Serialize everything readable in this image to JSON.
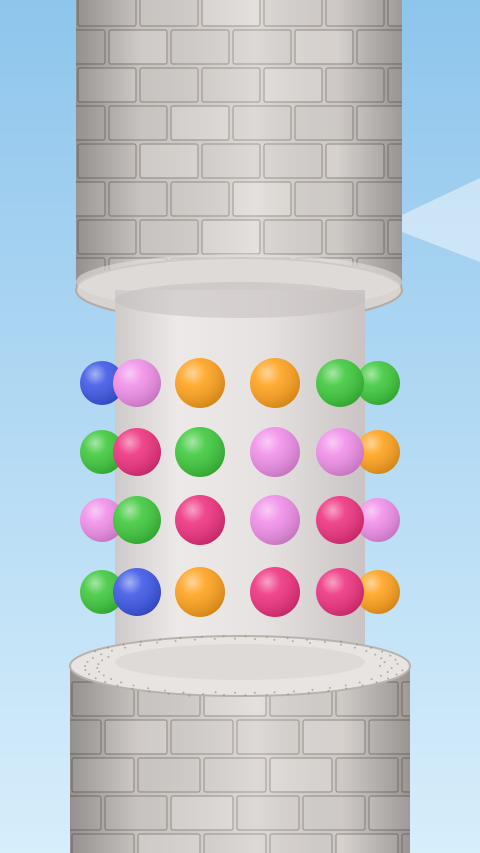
{
  "scene": {
    "title": "",
    "colors": {
      "sky_top": "#8ec5ec",
      "sky_bottom": "#d7eefb",
      "brick": "#d9d4d0",
      "brick_dark": "#a59d98",
      "mortar": "#8e8681",
      "core": "#e9e6e5",
      "core_shadow": "#c9c4c3"
    },
    "ball_colors": {
      "blue": "#3b55e6",
      "pink": "#f08de8",
      "orange": "#ffa11a",
      "green": "#3cc83a",
      "magenta": "#ee2f7d"
    },
    "balls": [
      {
        "row": 1,
        "col": 0,
        "color": "blue"
      },
      {
        "row": 1,
        "col": 1,
        "color": "pink"
      },
      {
        "row": 1,
        "col": 2,
        "color": "orange"
      },
      {
        "row": 1,
        "col": 3,
        "color": "orange"
      },
      {
        "row": 1,
        "col": 4,
        "color": "green"
      },
      {
        "row": 1,
        "col": 5,
        "color": "green"
      },
      {
        "row": 2,
        "col": 0,
        "color": "green"
      },
      {
        "row": 2,
        "col": 1,
        "color": "magenta"
      },
      {
        "row": 2,
        "col": 2,
        "color": "green"
      },
      {
        "row": 2,
        "col": 3,
        "color": "pink"
      },
      {
        "row": 2,
        "col": 4,
        "color": "pink"
      },
      {
        "row": 2,
        "col": 5,
        "color": "orange"
      },
      {
        "row": 3,
        "col": 0,
        "color": "pink"
      },
      {
        "row": 3,
        "col": 1,
        "color": "green"
      },
      {
        "row": 3,
        "col": 2,
        "color": "magenta"
      },
      {
        "row": 3,
        "col": 3,
        "color": "pink"
      },
      {
        "row": 3,
        "col": 4,
        "color": "magenta"
      },
      {
        "row": 3,
        "col": 5,
        "color": "pink"
      },
      {
        "row": 4,
        "col": 0,
        "color": "green"
      },
      {
        "row": 4,
        "col": 1,
        "color": "blue"
      },
      {
        "row": 4,
        "col": 2,
        "color": "orange"
      },
      {
        "row": 4,
        "col": 3,
        "color": "magenta"
      },
      {
        "row": 4,
        "col": 4,
        "color": "magenta"
      },
      {
        "row": 4,
        "col": 5,
        "color": "orange"
      }
    ]
  }
}
